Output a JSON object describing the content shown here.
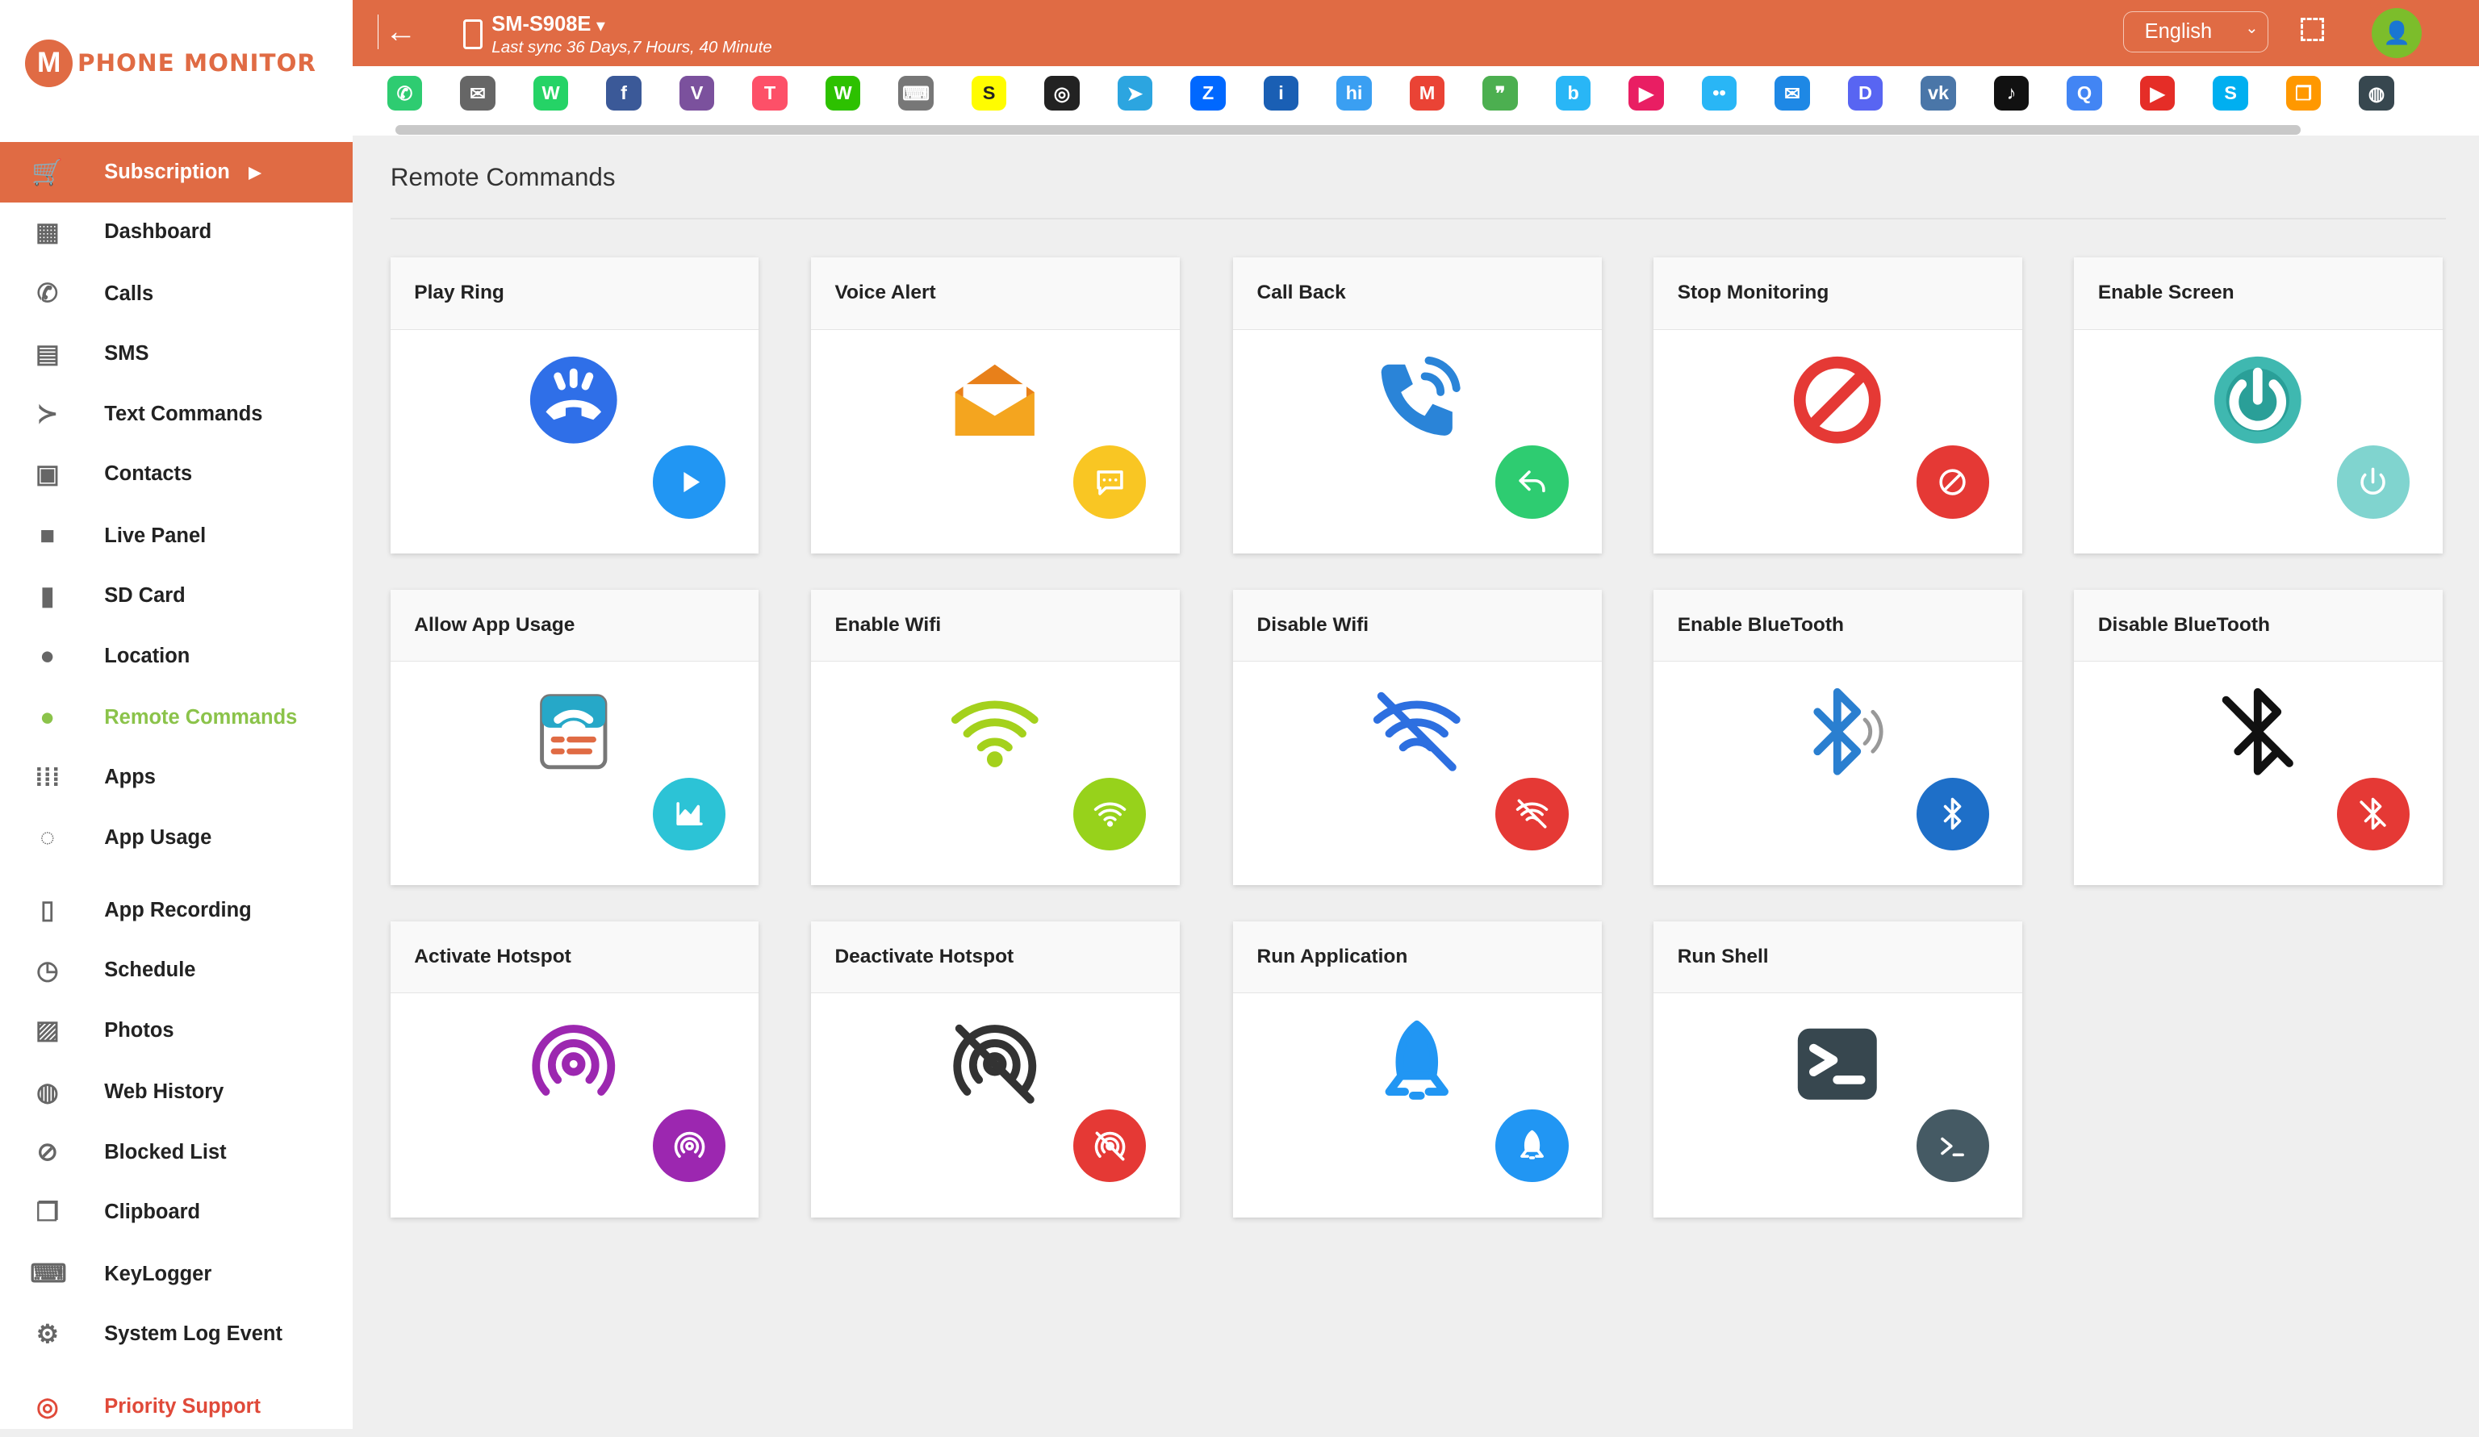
{
  "logo": {
    "letter": "M",
    "text": "PHONE MONITOR"
  },
  "sidebar": {
    "items": [
      {
        "label": "Subscription",
        "icon": "cart-icon",
        "glyph": "🛒",
        "type": "sub"
      },
      {
        "label": "Dashboard",
        "icon": "dashboard-icon",
        "glyph": "▦"
      },
      {
        "label": "Calls",
        "icon": "phone-icon",
        "glyph": "✆"
      },
      {
        "label": "SMS",
        "icon": "sms-icon",
        "glyph": "▤"
      },
      {
        "label": "Text Commands",
        "icon": "terminal-icon",
        "glyph": "≻"
      },
      {
        "label": "Contacts",
        "icon": "contacts-icon",
        "glyph": "▣"
      },
      {
        "label": "Live Panel",
        "icon": "video-icon",
        "glyph": "■"
      },
      {
        "label": "SD Card",
        "icon": "sdcard-icon",
        "glyph": "▮"
      },
      {
        "label": "Location",
        "icon": "location-icon",
        "glyph": "●"
      },
      {
        "label": "Remote Commands",
        "icon": "remote-icon",
        "glyph": "●",
        "type": "active"
      },
      {
        "label": "Apps",
        "icon": "apps-icon",
        "glyph": "⁞⁞⁞"
      },
      {
        "label": "App Usage",
        "icon": "usage-icon",
        "glyph": "◌"
      },
      {
        "label": "App Recording",
        "icon": "mobile-icon",
        "glyph": "▯"
      },
      {
        "label": "Schedule",
        "icon": "clock-icon",
        "glyph": "◷"
      },
      {
        "label": "Photos",
        "icon": "photos-icon",
        "glyph": "▨"
      },
      {
        "label": "Web History",
        "icon": "globe-icon",
        "glyph": "◍"
      },
      {
        "label": "Blocked List",
        "icon": "blocked-icon",
        "glyph": "⊘"
      },
      {
        "label": "Clipboard",
        "icon": "clipboard-icon",
        "glyph": "❐"
      },
      {
        "label": "KeyLogger",
        "icon": "keyboard-icon",
        "glyph": "⌨"
      },
      {
        "label": "System Log Event",
        "icon": "gears-icon",
        "glyph": "⚙"
      },
      {
        "label": "Priority Support",
        "icon": "lifebuoy-icon",
        "glyph": "◎",
        "type": "support"
      }
    ]
  },
  "topbar": {
    "back_glyph": "←",
    "device": "SM-S908E",
    "device_chevron": "▾",
    "last_sync": "Last sync 36 Days,7 Hours, 40 Minute",
    "language": "English",
    "lang_chevron": "⌄",
    "avatar_glyph": "👤"
  },
  "apps": [
    {
      "name": "calls",
      "color": "#2ecc71",
      "g": "✆"
    },
    {
      "name": "email",
      "color": "#666",
      "g": "✉"
    },
    {
      "name": "whatsapp",
      "color": "#25d366",
      "g": "W"
    },
    {
      "name": "facebook",
      "color": "#3b5998",
      "g": "f"
    },
    {
      "name": "viber",
      "color": "#7b519d",
      "g": "V"
    },
    {
      "name": "tinder",
      "color": "#fd5068",
      "g": "T"
    },
    {
      "name": "wechat",
      "color": "#2dc100",
      "g": "W"
    },
    {
      "name": "keyboard",
      "color": "#777",
      "g": "⌨"
    },
    {
      "name": "snapchat",
      "color": "#fffc00",
      "g": "S"
    },
    {
      "name": "instagram",
      "color": "#222",
      "g": "◎"
    },
    {
      "name": "telegram",
      "color": "#2ca5e0",
      "g": "➤"
    },
    {
      "name": "zalo",
      "color": "#0068ff",
      "g": "Z"
    },
    {
      "name": "imo",
      "color": "#1a5fb4",
      "g": "i"
    },
    {
      "name": "hike",
      "color": "#3a9ff2",
      "g": "hi"
    },
    {
      "name": "gmail",
      "color": "#ea4335",
      "g": "M"
    },
    {
      "name": "hangouts",
      "color": "#4caf50",
      "g": "❞"
    },
    {
      "name": "bip",
      "color": "#29b6f6",
      "g": "b"
    },
    {
      "name": "video-chat",
      "color": "#e91e63",
      "g": "▶"
    },
    {
      "name": "flickr",
      "color": "#29b6f6",
      "g": "••"
    },
    {
      "name": "messenger",
      "color": "#1e88e5",
      "g": "✉"
    },
    {
      "name": "discord",
      "color": "#5865f2",
      "g": "D"
    },
    {
      "name": "vk",
      "color": "#4a76a8",
      "g": "vk"
    },
    {
      "name": "tiktok",
      "color": "#111",
      "g": "♪"
    },
    {
      "name": "search",
      "color": "#4285f4",
      "g": "Q"
    },
    {
      "name": "youtube",
      "color": "#e52d27",
      "g": "▶"
    },
    {
      "name": "skype",
      "color": "#00aff0",
      "g": "S"
    },
    {
      "name": "files",
      "color": "#ff9800",
      "g": "❐"
    },
    {
      "name": "browser",
      "color": "#37474f",
      "g": "◍"
    }
  ],
  "main": {
    "title": "Remote Commands",
    "commands": [
      {
        "title": "Play Ring",
        "icon": "ring-icon",
        "color": "#2f6fe8",
        "badge": "play",
        "badge_color": "#2196f3"
      },
      {
        "title": "Voice Alert",
        "icon": "envelope-icon",
        "color": "#f4a51f",
        "badge": "chat",
        "badge_color": "#f9c623"
      },
      {
        "title": "Call Back",
        "icon": "callback-icon",
        "color": "#2a84d8",
        "badge": "reply",
        "badge_color": "#2ecc71"
      },
      {
        "title": "Stop Monitoring",
        "icon": "prohibit-icon",
        "color": "#e53935",
        "badge": "prohibit",
        "badge_color": "#e53935"
      },
      {
        "title": "Enable Screen",
        "icon": "power-icon",
        "color": "#3fb8b0",
        "badge": "power",
        "badge_color": "#80d4cf"
      },
      {
        "title": "Allow App Usage",
        "icon": "app-usage-icon",
        "color": "#26a8c8",
        "badge": "chart",
        "badge_color": "#2cc3d6"
      },
      {
        "title": "Enable Wifi",
        "icon": "wifi-icon",
        "color": "#a4d11c",
        "badge": "wifi",
        "badge_color": "#97d21b"
      },
      {
        "title": "Disable Wifi",
        "icon": "wifi-off-icon",
        "color": "#2d6fe0",
        "badge": "wifi-off",
        "badge_color": "#e53935"
      },
      {
        "title": "Enable BlueTooth",
        "icon": "bluetooth-icon",
        "color": "#2a7fd0",
        "badge": "bluetooth",
        "badge_color": "#1e6fc8"
      },
      {
        "title": "Disable BlueTooth",
        "icon": "bluetooth-off-icon",
        "color": "#111111",
        "badge": "bluetooth-off",
        "badge_color": "#e53935"
      },
      {
        "title": "Activate Hotspot",
        "icon": "hotspot-icon",
        "color": "#9c27b0",
        "badge": "hotspot",
        "badge_color": "#9c27b0"
      },
      {
        "title": "Deactivate Hotspot",
        "icon": "hotspot-off-icon",
        "color": "#333333",
        "badge": "hotspot-off",
        "badge_color": "#e53935"
      },
      {
        "title": "Run Application",
        "icon": "rocket-icon",
        "color": "#2196f3",
        "badge": "rocket",
        "badge_color": "#2196f3"
      },
      {
        "title": "Run Shell",
        "icon": "shell-icon",
        "color": "#37474f",
        "badge": "shell",
        "badge_color": "#455a64"
      }
    ]
  }
}
